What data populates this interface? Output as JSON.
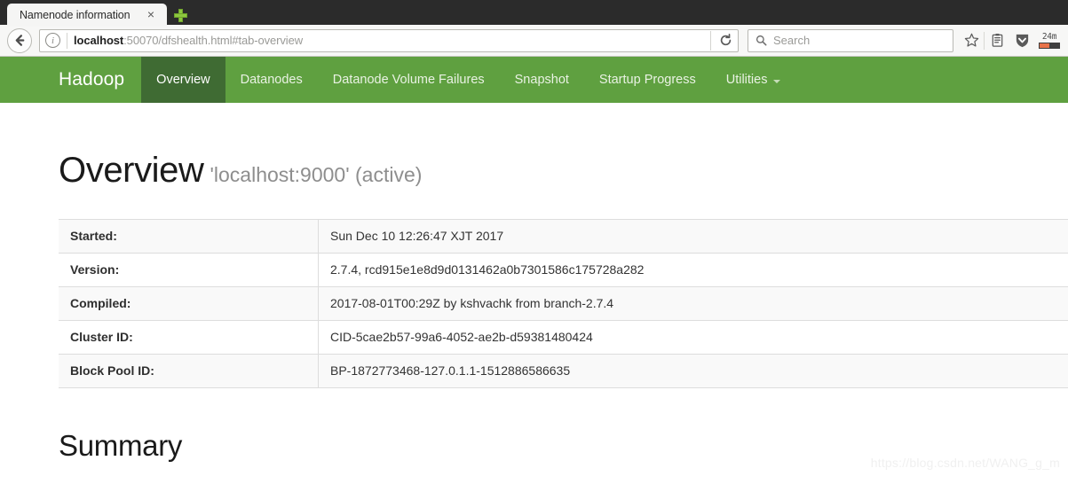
{
  "browser": {
    "tab": {
      "title": "Namenode information",
      "close_label": "×"
    },
    "newtab_label": "new-tab",
    "back_label": "Back",
    "url": {
      "host": "localhost",
      "rest": ":50070/dfshealth.html#tab-overview",
      "full": "localhost:50070/dfshealth.html#tab-overview"
    },
    "reload_label": "Reload",
    "search": {
      "placeholder": "Search"
    },
    "toolbar_icons": [
      {
        "name": "bookmark-star-icon",
        "glyph": "☆"
      },
      {
        "name": "reader-list-icon",
        "glyph": "☰"
      },
      {
        "name": "shield-download-icon",
        "glyph": "▼"
      }
    ],
    "addon": {
      "label": "24m",
      "fill_percent": 52,
      "fill_color": "#e8734a",
      "track_color": "#3f3f3f"
    }
  },
  "hadoop": {
    "brand": "Hadoop",
    "nav": [
      {
        "label": "Overview",
        "active": true
      },
      {
        "label": "Datanodes",
        "active": false
      },
      {
        "label": "Datanode Volume Failures",
        "active": false
      },
      {
        "label": "Snapshot",
        "active": false
      },
      {
        "label": "Startup Progress",
        "active": false
      },
      {
        "label": "Utilities",
        "active": false,
        "dropdown": true
      }
    ],
    "nav_colors": {
      "bar": "#5fa040",
      "active": "#3f6b33",
      "text": "#e9f2e3"
    },
    "overview": {
      "title": "Overview",
      "subtitle": "'localhost:9000' (active)"
    },
    "info_table": {
      "rows": [
        {
          "label": "Started:",
          "value": "Sun Dec 10 12:26:47 XJT 2017"
        },
        {
          "label": "Version:",
          "value": "2.7.4, rcd915e1e8d9d0131462a0b7301586c175728a282"
        },
        {
          "label": "Compiled:",
          "value": "2017-08-01T00:29Z by kshvachk from branch-2.7.4"
        },
        {
          "label": "Cluster ID:",
          "value": "CID-5cae2b57-99a6-4052-ae2b-d59381480424"
        },
        {
          "label": "Block Pool ID:",
          "value": "BP-1872773468-127.0.1.1-1512886586635"
        }
      ]
    },
    "summary": {
      "title": "Summary"
    }
  },
  "watermark": "https://blog.csdn.net/WANG_g_m"
}
